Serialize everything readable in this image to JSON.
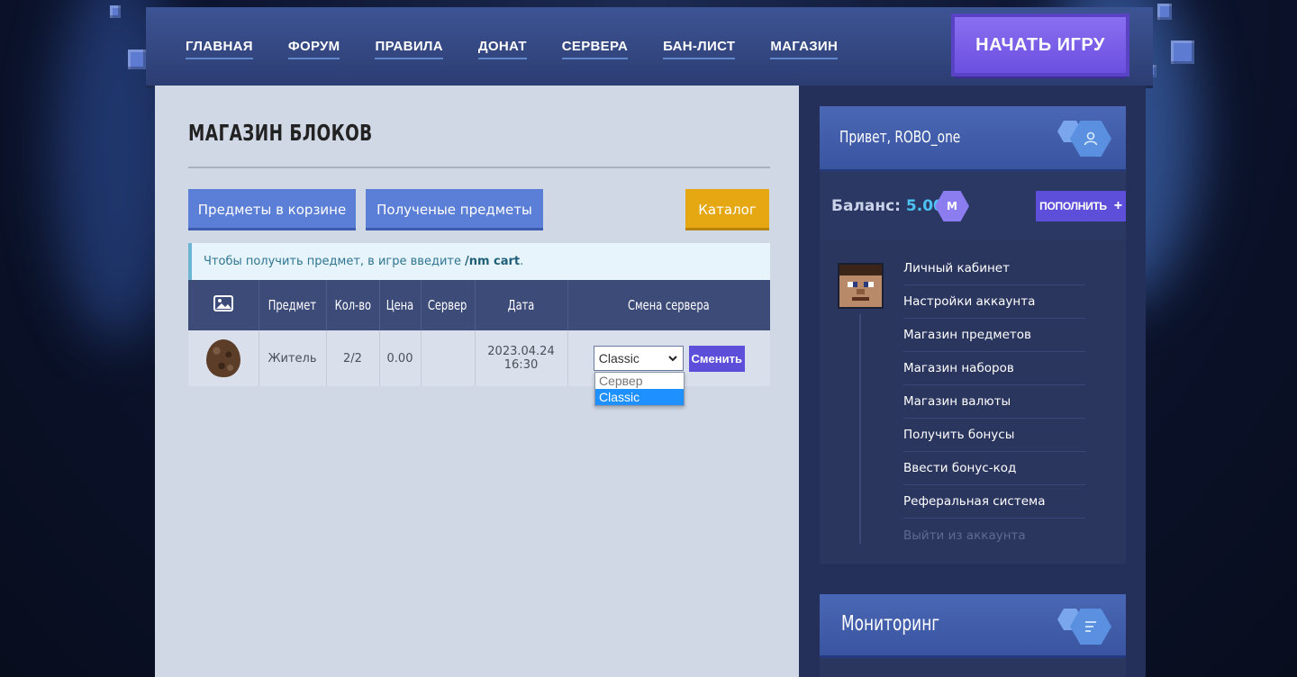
{
  "nav": {
    "items": [
      "ГЛАВНАЯ",
      "ФОРУМ",
      "ПРАВИЛА",
      "ДОНАТ",
      "СЕРВЕРА",
      "БАН-ЛИСТ",
      "МАГАЗИН"
    ],
    "play_label": "НАЧАТЬ ИГРУ"
  },
  "main": {
    "title": "МАГАЗИН БЛОКОВ",
    "cart_button": "Предметы в корзине",
    "received_button": "Полученые предметы",
    "catalog_button": "Каталог",
    "notice_text": "Чтобы получить предмет, в игре введите",
    "notice_command": "/nm cart",
    "notice_end": "."
  },
  "table": {
    "headers": [
      "",
      "Предмет",
      "Кол-во",
      "Цена",
      "Сервер",
      "Дата",
      "Смена сервера"
    ],
    "row": {
      "item_icon": "spawn-egg-icon",
      "item": "Житель",
      "quantity": "2/2",
      "price": "0.00",
      "server": "",
      "date": "2023.04.24",
      "time": "16:30",
      "selected_server": "Classic",
      "change_button": "Сменить"
    },
    "dropdown_options": [
      "Сервер",
      "Classic"
    ],
    "dropdown_selected": "Classic"
  },
  "sidebar": {
    "greeting": "Привет, ROBO_one",
    "balance_label": "Баланс:",
    "balance_value": "5.00",
    "coin_symbol": "M",
    "topup_label": "ПОПОЛНИТЬ",
    "menu": [
      "Личный кабинет",
      "Настройки аккаунта",
      "Магазин предметов",
      "Магазин наборов",
      "Магазин валюты",
      "Получить бонусы",
      "Ввести бонус-код",
      "Реферальная система",
      "Выйти из аккаунта"
    ],
    "monitoring_title": "Мониторинг"
  },
  "colors": {
    "accent_purple": "#5d4fd9",
    "button_blue": "#5b7fd6",
    "catalog_gold": "#e5a812",
    "balance_cyan": "#4cc3f0"
  }
}
